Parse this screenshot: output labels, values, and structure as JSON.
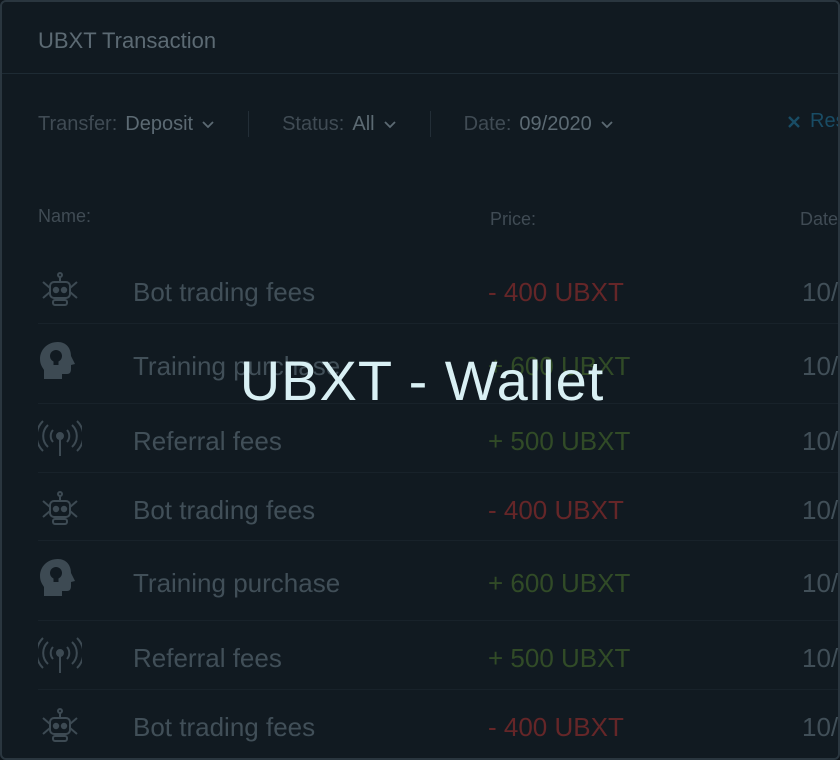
{
  "header": {
    "title": "UBXT Transaction"
  },
  "filters": {
    "transfer": {
      "label": "Transfer:",
      "value": "Deposit"
    },
    "status": {
      "label": "Status:",
      "value": "All"
    },
    "date": {
      "label": "Date:",
      "value": "09/2020"
    },
    "reset_label": "Res"
  },
  "columns": {
    "name": "Name:",
    "price": "Price:",
    "date": "Date"
  },
  "rows": [
    {
      "icon": "robot-icon",
      "name": "Bot trading fees",
      "price": "- 400 UBXT",
      "date": "10/"
    },
    {
      "icon": "idea-head-icon",
      "name": "Training purchase",
      "price": "+ 600 UBXT",
      "date": "10/"
    },
    {
      "icon": "broadcast-icon",
      "name": "Referral fees",
      "price": "+ 500 UBXT",
      "date": "10/"
    },
    {
      "icon": "robot-icon",
      "name": "Bot trading fees",
      "price": "- 400 UBXT",
      "date": "10/"
    },
    {
      "icon": "idea-head-icon",
      "name": "Training purchase",
      "price": "+ 600 UBXT",
      "date": "10/"
    },
    {
      "icon": "broadcast-icon",
      "name": "Referral fees",
      "price": "+ 500 UBXT",
      "date": "10/"
    },
    {
      "icon": "robot-icon",
      "name": "Bot trading fees",
      "price": "- 400 UBXT",
      "date": "10/"
    }
  ],
  "overlay": {
    "title": "UBXT - Wallet"
  },
  "colors": {
    "negative": "#7a2c2e",
    "positive": "#3b5a2c",
    "accent": "#1e5b78"
  }
}
